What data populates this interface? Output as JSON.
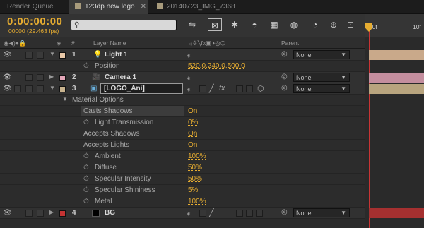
{
  "tabs": [
    {
      "label": "Render Queue",
      "active": false
    },
    {
      "label": "123dp new logo",
      "active": true
    },
    {
      "label": "20140723_IMG_7368",
      "active": false
    }
  ],
  "timecode": "0:00:00:00",
  "frames_fps": "00000 (29.463 fps)",
  "search": {
    "placeholder": ""
  },
  "ruler": {
    "start": "00f",
    "mark": "10f"
  },
  "columns": {
    "number": "#",
    "layer_name": "Layer Name",
    "parent": "Parent"
  },
  "layers": [
    {
      "num": "1",
      "name": "Light 1",
      "color": "#e8c8a8",
      "parent": "None",
      "bar_color": "#c9a98a"
    },
    {
      "num": "2",
      "name": "Camera 1",
      "color": "#e3a7b9",
      "parent": "None",
      "bar_color": "#c48e9e"
    },
    {
      "num": "3",
      "name": "[LOGO_Ani]",
      "color": "#c9b48f",
      "parent": "None",
      "bar_color": "#b8a47e"
    },
    {
      "num": "4",
      "name": "BG",
      "color": "#c43333",
      "parent": "None",
      "bar_color": "#a53030"
    }
  ],
  "light_props": {
    "label": "Position",
    "value": "520.0,240.0,500.0"
  },
  "material": {
    "group_label": "Material Options",
    "props": [
      {
        "label": "Casts Shadows",
        "value": "On",
        "stopwatch": false
      },
      {
        "label": "Light Transmission",
        "value": "0%",
        "stopwatch": true
      },
      {
        "label": "Accepts Shadows",
        "value": "On",
        "stopwatch": false
      },
      {
        "label": "Accepts Lights",
        "value": "On",
        "stopwatch": false
      },
      {
        "label": "Ambient",
        "value": "100%",
        "stopwatch": true
      },
      {
        "label": "Diffuse",
        "value": "50%",
        "stopwatch": true
      },
      {
        "label": "Specular Intensity",
        "value": "50%",
        "stopwatch": true
      },
      {
        "label": "Specular Shininess",
        "value": "5%",
        "stopwatch": true
      },
      {
        "label": "Metal",
        "value": "100%",
        "stopwatch": true
      }
    ]
  },
  "colors": {
    "accent": "#e5ac31",
    "playhead": "#c83434"
  }
}
